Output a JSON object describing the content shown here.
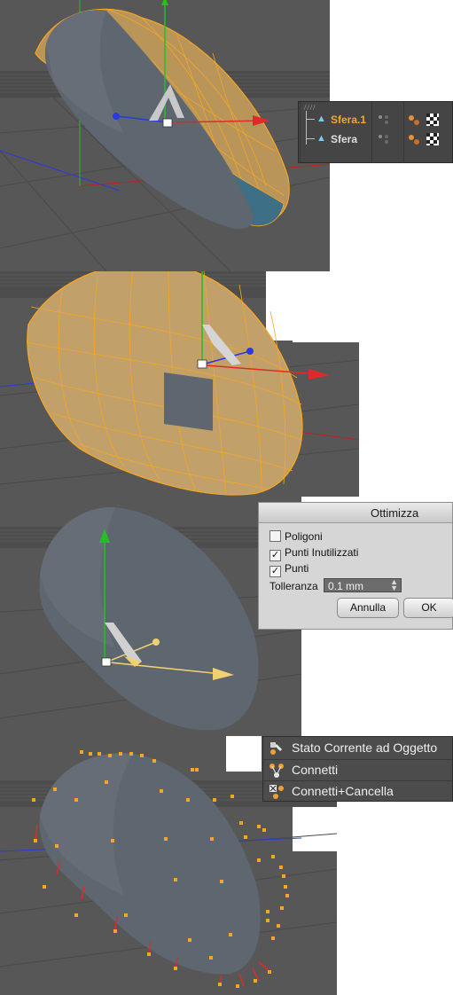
{
  "object_manager": {
    "objects": [
      {
        "name": "Sfera.1",
        "selected": true
      },
      {
        "name": "Sfera",
        "selected": false
      }
    ]
  },
  "optimize_dialog": {
    "title": "Ottimizza",
    "options": [
      {
        "label": "Poligoni",
        "checked": false
      },
      {
        "label": "Punti Inutilizzati",
        "checked": true
      },
      {
        "label": "Punti",
        "checked": true
      }
    ],
    "tolerance_label": "Tolleranza",
    "tolerance_value": "0.1 mm",
    "cancel_label": "Annulla",
    "ok_label": "OK"
  },
  "context_menu": {
    "items": [
      {
        "label": "Stato Corrente ad Oggetto",
        "icon": "current-state-to-object-icon"
      },
      {
        "label": "Connetti",
        "icon": "connect-icon"
      },
      {
        "label": "Connetti+Cancella",
        "icon": "connect-delete-icon"
      }
    ]
  },
  "colors": {
    "selection": "#f5a623",
    "viewport_bg": "#5a5a5a",
    "mesh": "#596068",
    "axis_x": "#e02a2a",
    "axis_y": "#22c022",
    "axis_z": "#2a3adf"
  }
}
